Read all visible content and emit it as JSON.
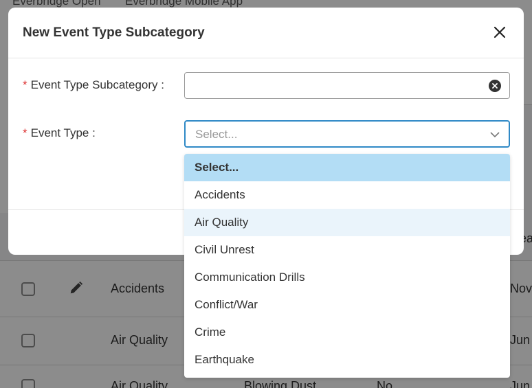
{
  "background": {
    "tabs": [
      "Everbridge Open",
      "Everbridge Mobile App"
    ],
    "header_partial": "ea",
    "rows": [
      {
        "name": "Accidents",
        "date_partial": "Nov"
      },
      {
        "name": "Air Quality",
        "date_partial": "Jun"
      },
      {
        "name": "Air Quality",
        "subcategory": "Blowing Dust",
        "flag": "No",
        "date_partial": "Jun"
      }
    ]
  },
  "modal": {
    "title": "New Event Type Subcategory",
    "fields": {
      "subcategory": {
        "required_mark": "*",
        "label": "Event Type Subcategory :",
        "value": ""
      },
      "event_type": {
        "required_mark": "*",
        "label": "Event Type :",
        "placeholder": "Select..."
      }
    },
    "icons": {
      "close": "close-icon",
      "clear": "clear-circle-icon",
      "chevron": "chevron-down-icon"
    }
  },
  "dropdown": {
    "options": [
      "Select...",
      "Accidents",
      "Air Quality",
      "Civil Unrest",
      "Communication Drills",
      "Conflict/War",
      "Crime",
      "Earthquake"
    ],
    "selected_index": 0,
    "hover_index": 2
  },
  "colors": {
    "accent": "#2f89c6",
    "selected_bg": "#b3ddf5",
    "required": "#d33"
  }
}
